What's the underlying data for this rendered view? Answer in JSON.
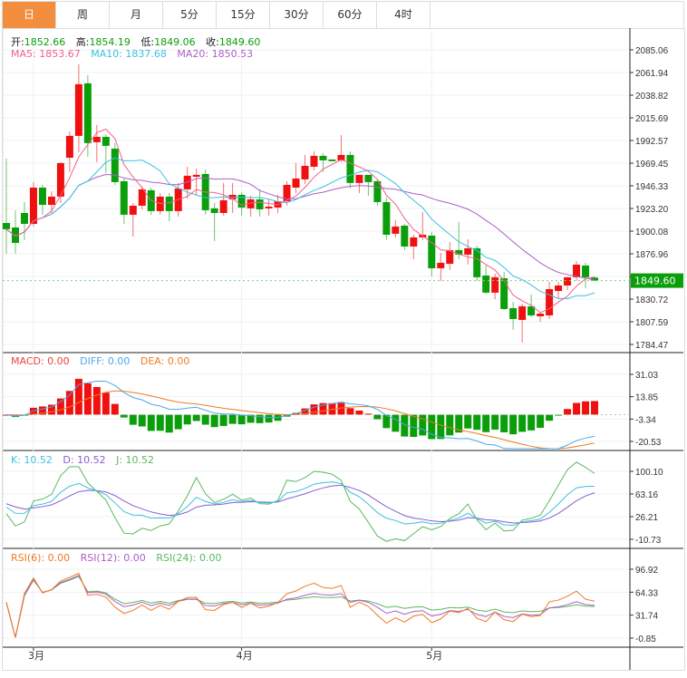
{
  "tabs": [
    {
      "label": "日",
      "active": true
    },
    {
      "label": "周"
    },
    {
      "label": "月"
    },
    {
      "label": "5分"
    },
    {
      "label": "15分"
    },
    {
      "label": "30分"
    },
    {
      "label": "60分"
    },
    {
      "label": "4时"
    }
  ],
  "ohlc_info": {
    "open_label": "开:",
    "open": "1852.66",
    "high_label": "高:",
    "high": "1854.19",
    "low_label": "低:",
    "low": "1849.06",
    "close_label": "收:",
    "close": "1849.60"
  },
  "ma_info": {
    "ma5": "MA5: 1853.67",
    "ma10": "MA10: 1837.68",
    "ma20": "MA20: 1850.53"
  },
  "macd_info": {
    "macd": "MACD: 0.00",
    "diff": "DIFF: 0.00",
    "dea": "DEA: 0.00"
  },
  "kdj_info": {
    "k": "K: 10.52",
    "d": "D: 10.52",
    "j": "J: 10.52"
  },
  "rsi_info": {
    "rsi6": "RSI(6): 0.00",
    "rsi12": "RSI(12): 0.00",
    "rsi24": "RSI(24): 0.00"
  },
  "current_price": "1849.60",
  "colors": {
    "up": "#f01010",
    "down": "#0a9e0a",
    "ma5": "#f0608a",
    "ma10": "#3cc0e0",
    "ma20": "#b05cc8",
    "diff": "#4aa8ec",
    "dea": "#f07a20",
    "k": "#3cc0e0",
    "d": "#8a5cd0",
    "j": "#5cb85c",
    "rsi6": "#f07a20",
    "rsi12": "#b05cc8",
    "rsi24": "#5cb85c",
    "active_tab": "#f28e3e"
  },
  "chart_data": {
    "type": "candlestick",
    "price_axis": {
      "ticks": [
        "2085.06",
        "2061.94",
        "2038.82",
        "2015.69",
        "1992.57",
        "1969.45",
        "1946.33",
        "1923.20",
        "1900.08",
        "1876.96",
        "1853.84",
        "1830.72",
        "1807.59",
        "1784.47"
      ],
      "range": [
        1784.47,
        2085.06
      ]
    },
    "macd_axis": {
      "ticks": [
        "31.03",
        "13.85",
        "-3.34",
        "-20.53"
      ],
      "range": [
        -20.53,
        31.03
      ]
    },
    "kdj_axis": {
      "ticks": [
        "100.10",
        "63.16",
        "26.21",
        "-10.73"
      ],
      "range": [
        -10.73,
        100.1
      ]
    },
    "rsi_axis": {
      "ticks": [
        "96.92",
        "64.33",
        "31.74",
        "-0.85"
      ],
      "range": [
        -0.85,
        96.92
      ]
    },
    "x_labels": [
      {
        "label": "3月",
        "index": 3
      },
      {
        "label": "4月",
        "index": 26
      },
      {
        "label": "5月",
        "index": 47
      }
    ],
    "candles": [
      [
        1908.4,
        1974.1,
        1877.0,
        1902.0
      ],
      [
        1903.8,
        1921.4,
        1877.0,
        1888.1
      ],
      [
        1918.6,
        1929.7,
        1890.9,
        1907.5
      ],
      [
        1907.5,
        1950.1,
        1904.8,
        1944.5
      ],
      [
        1944.5,
        1947.3,
        1916.8,
        1926.9
      ],
      [
        1926.9,
        1940.8,
        1918.6,
        1935.3
      ],
      [
        1935.3,
        1970.4,
        1928.8,
        1969.5
      ],
      [
        1975.0,
        2001.9,
        1960.3,
        1997.3
      ],
      [
        1997.3,
        2070.3,
        1980.6,
        2050.0
      ],
      [
        2050.9,
        2059.2,
        1976.0,
        1989.9
      ],
      [
        1990.8,
        2008.4,
        1970.4,
        1996.3
      ],
      [
        1996.3,
        1999.1,
        1959.3,
        1987.1
      ],
      [
        1984.3,
        1989.9,
        1947.3,
        1950.1
      ],
      [
        1951.0,
        1953.8,
        1907.5,
        1916.8
      ],
      [
        1916.8,
        1928.8,
        1894.6,
        1926.0
      ],
      [
        1926.0,
        1945.5,
        1922.3,
        1942.7
      ],
      [
        1941.8,
        1944.5,
        1916.8,
        1920.5
      ],
      [
        1920.5,
        1939.0,
        1916.8,
        1935.3
      ],
      [
        1935.3,
        1939.0,
        1910.3,
        1920.5
      ],
      [
        1920.5,
        1949.2,
        1914.9,
        1943.6
      ],
      [
        1942.7,
        1965.8,
        1933.4,
        1956.6
      ],
      [
        1955.6,
        1964.0,
        1937.1,
        1957.5
      ],
      [
        1958.4,
        1963.0,
        1916.8,
        1921.4
      ],
      [
        1923.3,
        1928.8,
        1890.0,
        1918.6
      ],
      [
        1918.6,
        1949.2,
        1915.9,
        1931.6
      ],
      [
        1932.5,
        1949.2,
        1918.6,
        1937.1
      ],
      [
        1937.1,
        1939.9,
        1915.9,
        1924.2
      ],
      [
        1923.3,
        1936.2,
        1914.9,
        1932.5
      ],
      [
        1932.5,
        1942.7,
        1914.9,
        1922.3
      ],
      [
        1923.3,
        1932.5,
        1915.9,
        1925.1
      ],
      [
        1924.2,
        1937.1,
        1918.6,
        1930.6
      ],
      [
        1930.6,
        1951.0,
        1926.0,
        1947.3
      ],
      [
        1944.5,
        1969.5,
        1939.0,
        1953.8
      ],
      [
        1952.9,
        1977.8,
        1948.3,
        1966.7
      ],
      [
        1965.8,
        1981.5,
        1962.1,
        1976.9
      ],
      [
        1976.9,
        1979.7,
        1960.3,
        1972.3
      ],
      [
        1973.2,
        1973.2,
        1971.4,
        1971.4
      ],
      [
        1972.3,
        1998.2,
        1970.4,
        1977.8
      ],
      [
        1977.8,
        1981.5,
        1943.6,
        1949.2
      ],
      [
        1949.2,
        1957.5,
        1939.0,
        1957.5
      ],
      [
        1957.5,
        1957.5,
        1936.2,
        1950.1
      ],
      [
        1951.0,
        1952.9,
        1926.0,
        1929.7
      ],
      [
        1929.7,
        1934.4,
        1890.9,
        1896.4
      ],
      [
        1897.4,
        1911.2,
        1893.7,
        1904.8
      ],
      [
        1905.7,
        1907.5,
        1880.7,
        1884.4
      ],
      [
        1884.4,
        1896.4,
        1871.5,
        1893.7
      ],
      [
        1893.7,
        1919.6,
        1890.9,
        1896.4
      ],
      [
        1895.5,
        1899.2,
        1853.9,
        1862.2
      ],
      [
        1862.2,
        1877.9,
        1849.3,
        1867.8
      ],
      [
        1866.8,
        1889.0,
        1860.4,
        1880.7
      ],
      [
        1880.7,
        1909.4,
        1871.5,
        1876.1
      ],
      [
        1876.1,
        1891.8,
        1865.9,
        1882.6
      ],
      [
        1882.6,
        1885.3,
        1849.3,
        1853.0
      ],
      [
        1854.8,
        1865.0,
        1836.3,
        1837.3
      ],
      [
        1837.3,
        1856.7,
        1830.8,
        1853.0
      ],
      [
        1852.0,
        1858.5,
        1819.7,
        1820.6
      ],
      [
        1821.5,
        1828.0,
        1799.3,
        1810.4
      ],
      [
        1809.5,
        1826.1,
        1786.4,
        1823.4
      ],
      [
        1823.4,
        1835.4,
        1812.3,
        1814.1
      ],
      [
        1813.2,
        1816.9,
        1807.6,
        1815.9
      ],
      [
        1814.1,
        1848.3,
        1810.4,
        1840.9
      ],
      [
        1839.0,
        1848.3,
        1831.7,
        1844.6
      ],
      [
        1844.6,
        1853.0,
        1840.0,
        1853.0
      ],
      [
        1853.0,
        1869.6,
        1849.3,
        1865.9
      ],
      [
        1865.0,
        1867.8,
        1841.9,
        1853.0
      ],
      [
        1852.66,
        1854.19,
        1849.06,
        1849.6
      ]
    ]
  }
}
